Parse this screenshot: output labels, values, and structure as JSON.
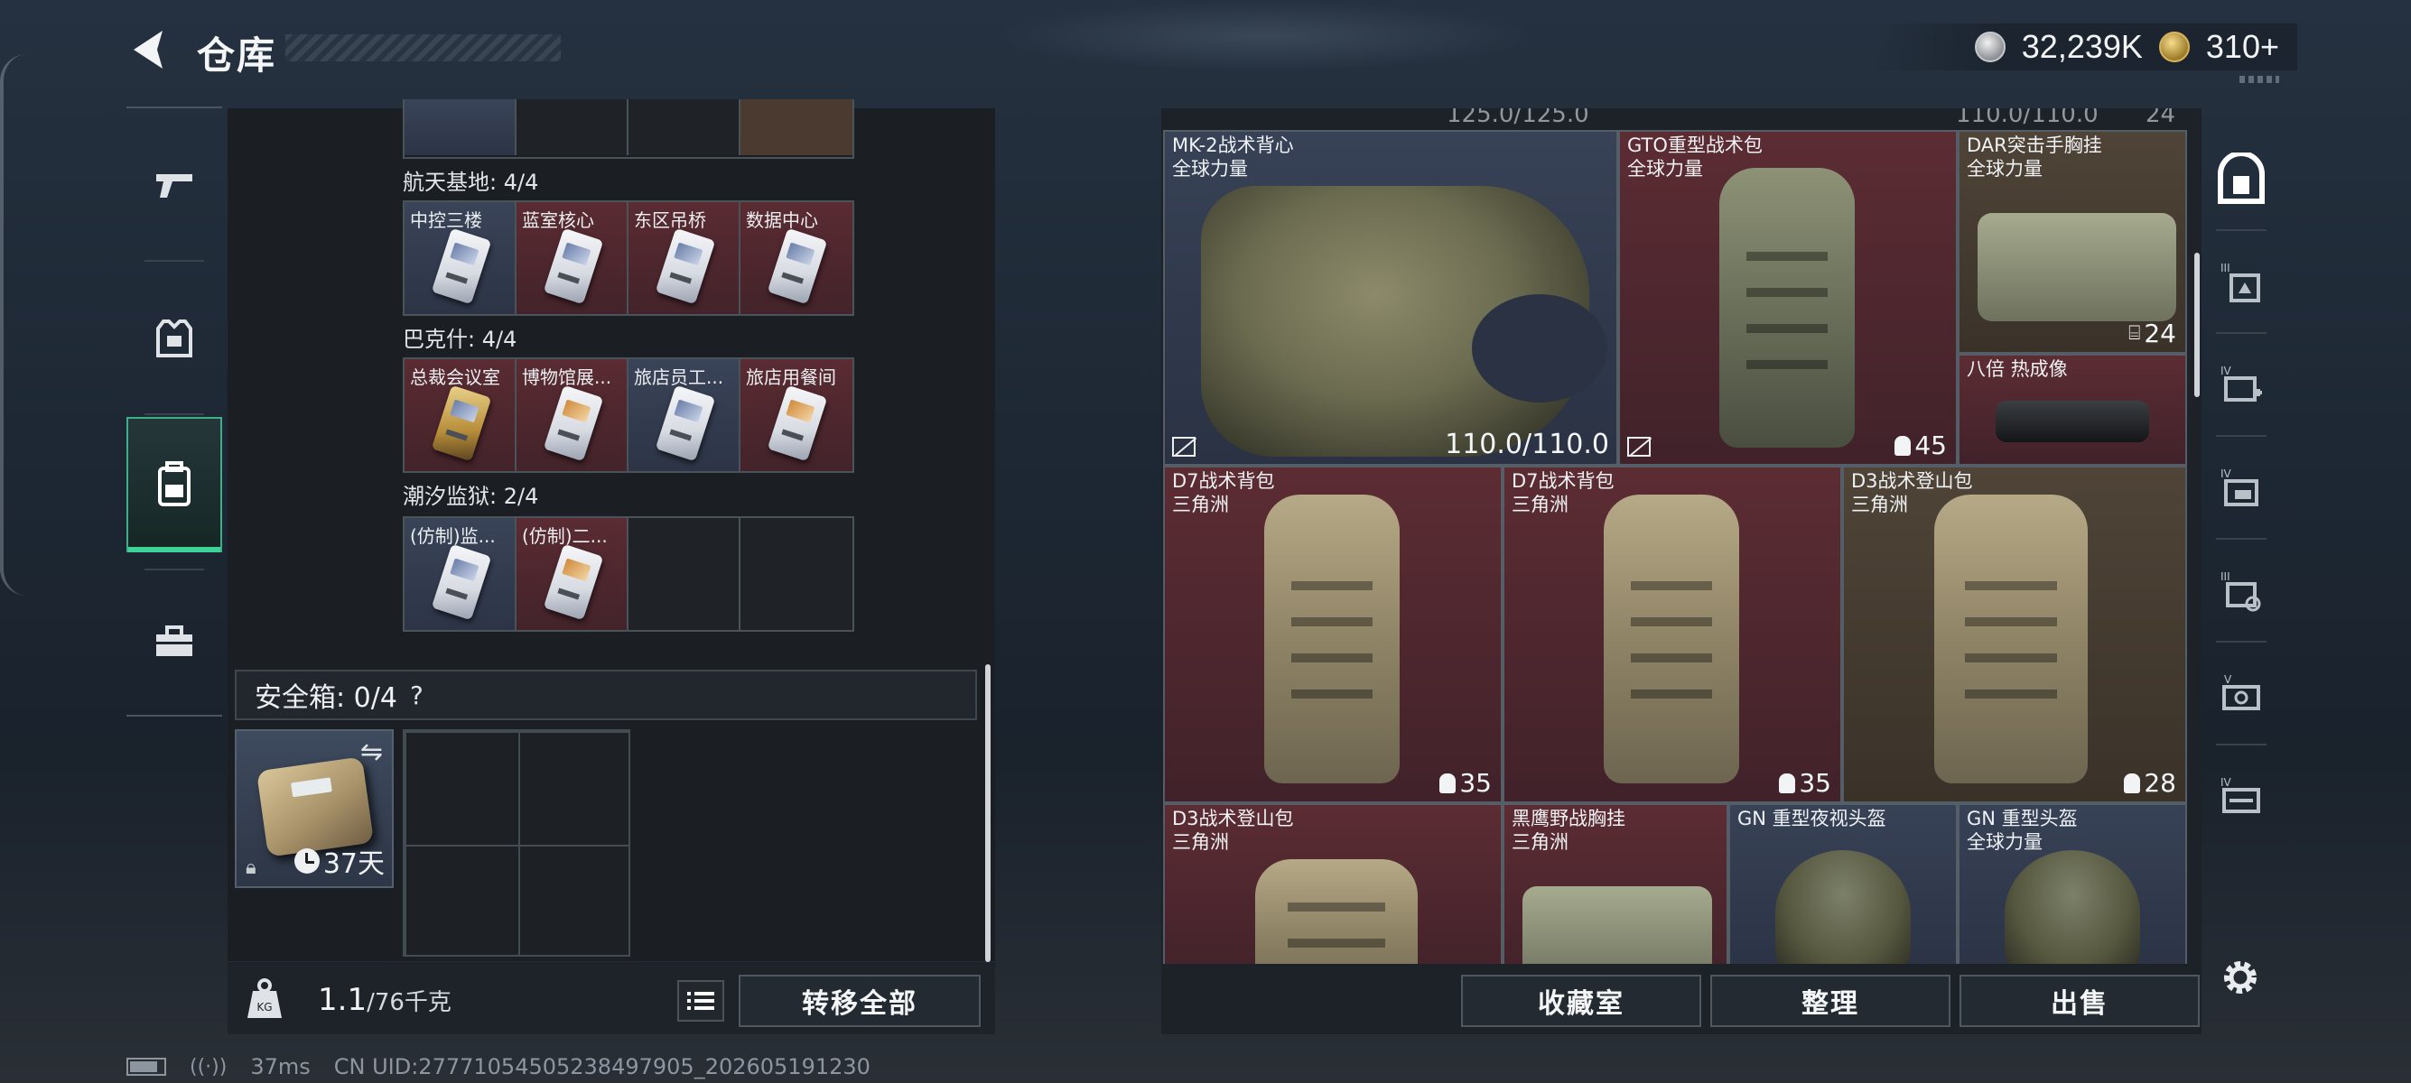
{
  "header": {
    "title": "仓库",
    "currency_silver": "32,239K",
    "currency_gold": "310+"
  },
  "left_nav": [
    {
      "icon": "pistol-icon"
    },
    {
      "icon": "armor-icon"
    },
    {
      "icon": "backpack-icon",
      "active": true
    },
    {
      "icon": "toolbox-icon"
    }
  ],
  "stash": {
    "sections": [
      {
        "title": "航天基地: 4/4",
        "cards": [
          {
            "name": "中控三楼",
            "color": "blue"
          },
          {
            "name": "蓝室核心",
            "color": "red"
          },
          {
            "name": "东区吊桥",
            "color": "red"
          },
          {
            "name": "数据中心",
            "color": "red"
          }
        ]
      },
      {
        "title": "巴克什: 4/4",
        "cards": [
          {
            "name": "总裁会议室",
            "color": "red"
          },
          {
            "name": "博物馆展...",
            "color": "red"
          },
          {
            "name": "旅店员工...",
            "color": "blue"
          },
          {
            "name": "旅店用餐间",
            "color": "red"
          }
        ]
      },
      {
        "title": "潮汐监狱: 2/4",
        "cards": [
          {
            "name": "(仿制)监...",
            "color": "blue"
          },
          {
            "name": "(仿制)二...",
            "color": "red"
          },
          {
            "name": "",
            "color": "empty"
          },
          {
            "name": "",
            "color": "empty"
          }
        ]
      }
    ],
    "safebox_label": "安全箱: 0/4",
    "safebox_help": "?",
    "safebox_days": "37天",
    "weight_current": "1.1",
    "weight_max": "/76千克",
    "transfer_all": "转移全部"
  },
  "inventory": {
    "partial_top": [
      "125.0/125.0",
      "110.0/110.0",
      "24"
    ],
    "items": [
      {
        "name": "MK-2战术背心",
        "origin": "全球力量",
        "durability": "110.0/110.0",
        "color": "blue"
      },
      {
        "name": "GTO重型战术包",
        "origin": "全球力量",
        "capacity": "45",
        "color": "red"
      },
      {
        "name": "DAR突击手胸挂",
        "origin": "全球力量",
        "capacity": "24",
        "color": "brown"
      },
      {
        "name": "八倍 热成像",
        "origin": "",
        "color": "red"
      },
      {
        "name": "D7战术背包",
        "origin": "三角洲",
        "capacity": "35",
        "color": "red"
      },
      {
        "name": "D7战术背包",
        "origin": "三角洲",
        "capacity": "35",
        "color": "red"
      },
      {
        "name": "D3战术登山包",
        "origin": "三角洲",
        "capacity": "28",
        "color": "brown"
      },
      {
        "name": "D3战术登山包",
        "origin": "三角洲",
        "color": "red"
      },
      {
        "name": "黑鹰野战胸挂",
        "origin": "三角洲",
        "color": "red"
      },
      {
        "name": "GN 重型夜视头盔",
        "origin": "",
        "color": "blue"
      },
      {
        "name": "GN 重型头盔",
        "origin": "全球力量",
        "color": "blue"
      }
    ],
    "buttons": {
      "collection": "收藏室",
      "sort": "整理",
      "sell": "出售"
    }
  },
  "right_nav": [
    {
      "icon": "safe-icon"
    },
    {
      "icon": "tier3-armor-icon"
    },
    {
      "icon": "tier4-medkit-icon"
    },
    {
      "icon": "tier4-rig-icon"
    },
    {
      "icon": "tier3-gear-icon"
    },
    {
      "icon": "tier5-key-icon"
    },
    {
      "icon": "tier4-weapon-icon"
    }
  ],
  "status_bar": {
    "ping": "37ms",
    "uid": "CN UID:27771054505238497905_202605191230"
  },
  "colors": {
    "accent": "#3fd39a",
    "item_blue": "#384256",
    "item_red": "#5c2c33",
    "item_brown": "#4f4437"
  }
}
